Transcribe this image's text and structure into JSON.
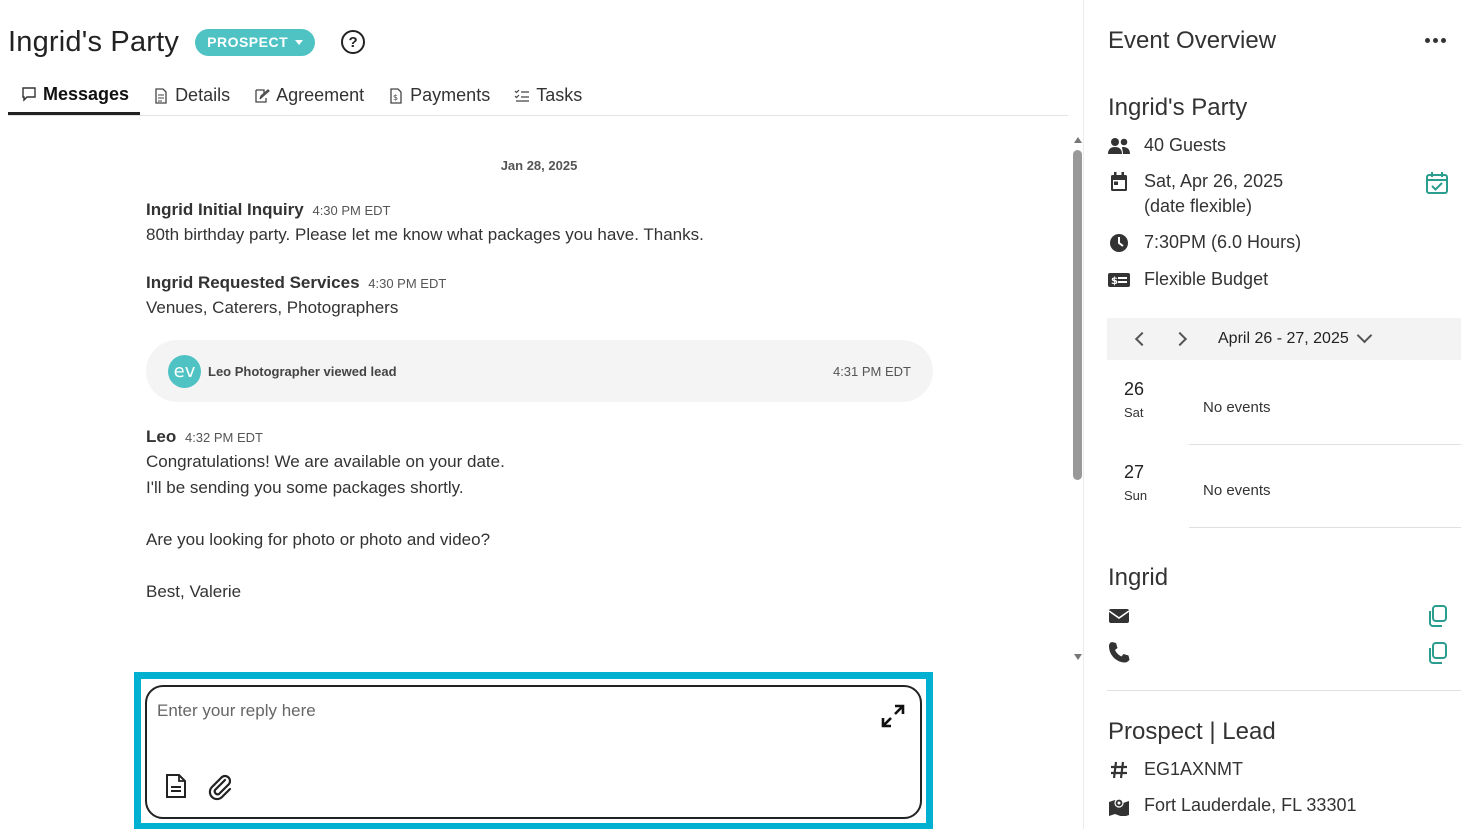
{
  "header": {
    "title": "Ingrid's Party",
    "status": "PROSPECT",
    "help_glyph": "?"
  },
  "tabs": [
    {
      "label": "Messages",
      "icon": "chat-bubble-icon",
      "active": true
    },
    {
      "label": "Details",
      "icon": "document-icon",
      "active": false
    },
    {
      "label": "Agreement",
      "icon": "signature-icon",
      "active": false
    },
    {
      "label": "Payments",
      "icon": "invoice-icon",
      "active": false
    },
    {
      "label": "Tasks",
      "icon": "checklist-icon",
      "active": false
    }
  ],
  "thread": {
    "date": "Jan 28, 2025",
    "messages": [
      {
        "author": "Ingrid Initial Inquiry",
        "time": "4:30 PM EDT",
        "body": "80th birthday party. Please let me know what packages you have. Thanks."
      },
      {
        "author": "Ingrid Requested Services",
        "time": "4:30 PM EDT",
        "body": "Venues, Caterers, Photographers"
      },
      {
        "author": "Leo",
        "time": "4:32 PM EDT",
        "body": "Congratulations! We are available on your date.\nI'll be sending you some packages shortly.\n\nAre you looking for photo or photo and video?\n\nBest, Valerie"
      }
    ],
    "activity": {
      "logo": "ev",
      "text": "Leo Photographer viewed lead",
      "time": "4:31 PM EDT"
    }
  },
  "reply": {
    "placeholder": "Enter your reply here",
    "value": ""
  },
  "panel": {
    "title": "Event Overview",
    "event_name": "Ingrid's Party",
    "guests": "40 Guests",
    "date": "Sat, Apr 26, 2025",
    "date_note": "(date flexible)",
    "time": "7:30PM (6.0 Hours)",
    "budget": "Flexible Budget",
    "calendar": {
      "range": "April 26 - 27, 2025",
      "days": [
        {
          "num": "26",
          "dow": "Sat",
          "events": "No events"
        },
        {
          "num": "27",
          "dow": "Sun",
          "events": "No events"
        }
      ]
    },
    "client_name": "Ingrid",
    "lead_title": "Prospect | Lead",
    "lead_id": "EG1AXNMT",
    "location": "Fort Lauderdale, FL 33301"
  },
  "colors": {
    "accent": "#4fc3c4",
    "highlight": "#00b0d1",
    "teal_icon": "#2a9d8f"
  }
}
